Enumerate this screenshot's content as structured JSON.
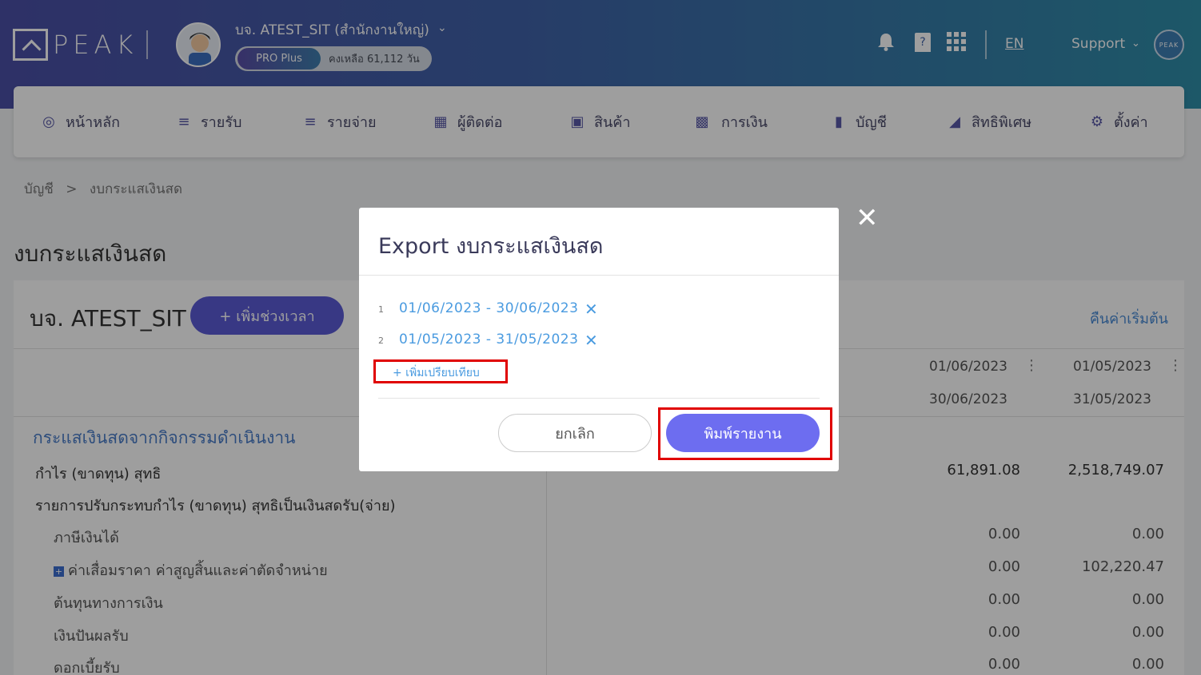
{
  "header": {
    "logo_text": "PEAK",
    "company_name": "บจ. ATEST_SIT (สำนักงานใหญ่)",
    "plan": "PRO Plus",
    "remaining": "คงเหลือ 61,112 วัน",
    "lang": "EN",
    "support": "Support",
    "avatar_text": "PEAK",
    "icons": [
      "bell-icon",
      "help-book-icon",
      "apps-grid-icon"
    ]
  },
  "nav": {
    "items": [
      {
        "label": "หน้าหลัก",
        "icon": "dashboard-icon"
      },
      {
        "label": "รายรับ",
        "icon": "income-icon"
      },
      {
        "label": "รายจ่าย",
        "icon": "expense-icon"
      },
      {
        "label": "ผู้ติดต่อ",
        "icon": "contacts-icon"
      },
      {
        "label": "สินค้า",
        "icon": "product-box-icon"
      },
      {
        "label": "การเงิน",
        "icon": "money-icon"
      },
      {
        "label": "บัญชี",
        "icon": "ledger-icon"
      },
      {
        "label": "สิทธิพิเศษ",
        "icon": "megaphone-icon"
      },
      {
        "label": "ตั้งค่า",
        "icon": "gear-icon"
      }
    ]
  },
  "breadcrumb": {
    "parent": "บัญชี",
    "sep": ">",
    "current": "งบกระแสเงินสด"
  },
  "page": {
    "title": "งบกระแสเงินสด"
  },
  "card": {
    "company": "บจ. ATEST_SIT",
    "add_period": "+ เพิ่มช่วงเวลา",
    "reset": "คืนค่าเริ่มต้น",
    "columns": [
      {
        "from": "01/06/2023",
        "to": "30/06/2023"
      },
      {
        "from": "01/05/2023",
        "to": "31/05/2023"
      }
    ],
    "section_title": "กระแสเงินสดจากกิจกรรมดำเนินงาน",
    "rows": [
      {
        "label": "กำไร (ขาดทุน) สุทธิ",
        "v1": "61,891.08",
        "v2": "2,518,749.07"
      },
      {
        "label": "รายการปรับกระทบกำไร (ขาดทุน) สุทธิเป็นเงินสดรับ(จ่าย)",
        "v1": "",
        "v2": ""
      },
      {
        "label": "ภาษีเงินได้",
        "v1": "0.00",
        "v2": "0.00"
      },
      {
        "label": "ค่าเสื่อมราคา ค่าสูญสิ้นและค่าตัดจำหน่าย",
        "v1": "0.00",
        "v2": "102,220.47"
      },
      {
        "label": "ต้นทุนทางการเงิน",
        "v1": "0.00",
        "v2": "0.00"
      },
      {
        "label": "เงินปันผลรับ",
        "v1": "0.00",
        "v2": "0.00"
      },
      {
        "label": "ดอกเบี้ยรับ",
        "v1": "0.00",
        "v2": "0.00"
      }
    ]
  },
  "modal": {
    "title": "Export งบกระแสเงินสด",
    "periods": [
      {
        "num": "1",
        "range": "01/06/2023 - 30/06/2023"
      },
      {
        "num": "2",
        "range": "01/05/2023 - 31/05/2023"
      }
    ],
    "compare_link": "+ เพิ่มเปรียบเทียบ",
    "cancel": "ยกเลิก",
    "print": "พิมพ์รายงาน",
    "close": "✕"
  }
}
